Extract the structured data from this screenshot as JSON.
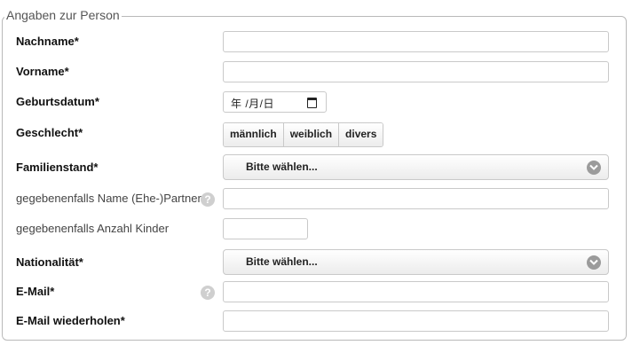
{
  "section": {
    "legend": "Angaben zur Person"
  },
  "fields": {
    "nachname": {
      "label": "Nachname*",
      "value": ""
    },
    "vorname": {
      "label": "Vorname*",
      "value": ""
    },
    "geburtsdatum": {
      "label": "Geburtsdatum*",
      "placeholder": "年 /月/日"
    },
    "geschlecht": {
      "label": "Geschlecht*",
      "options": [
        "männlich",
        "weiblich",
        "divers"
      ]
    },
    "familienstand": {
      "label": "Familienstand*",
      "selected": "Bitte wählen..."
    },
    "partner": {
      "label": "gegebenenfalls Name (Ehe-)Partner",
      "value": ""
    },
    "kinder": {
      "label": "gegebenenfalls Anzahl Kinder",
      "value": ""
    },
    "nationalitaet": {
      "label": "Nationalität*",
      "selected": "Bitte wählen..."
    },
    "email": {
      "label": "E-Mail*",
      "value": ""
    },
    "email_repeat": {
      "label": "E-Mail wiederholen*",
      "value": ""
    }
  },
  "icons": {
    "help": "question-circle-icon",
    "select": "chevron-down-circle-icon",
    "calendar": "calendar-icon"
  },
  "colors": {
    "border": "#c9c9c9",
    "help_icon": "#cfcfcf",
    "chevron": "#9b9b9b"
  }
}
